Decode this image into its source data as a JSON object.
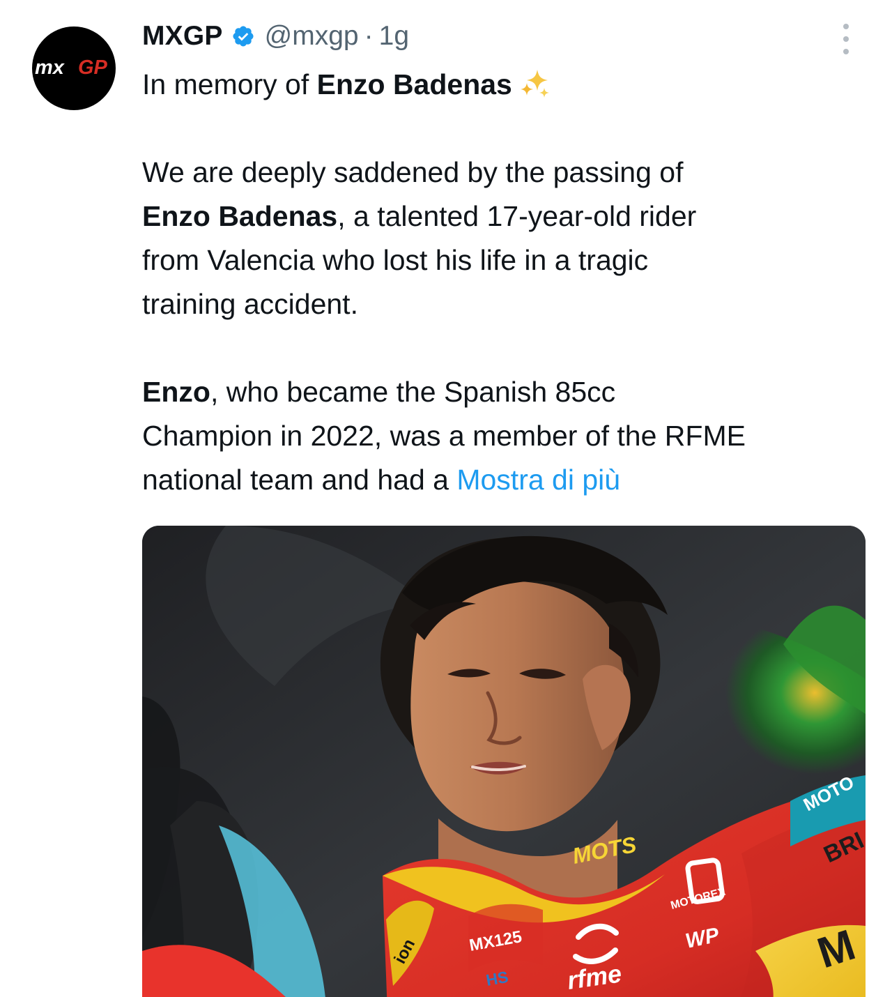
{
  "author": {
    "display_name": "MXGP",
    "handle": "@mxgp",
    "separator": "·",
    "timestamp": "1g",
    "avatar_logo_text": "MXGP",
    "verified": true,
    "verified_badge_color": "#1d9bf0"
  },
  "tweet": {
    "title_prefix": "In memory of ",
    "title_name": "Enzo Badenas",
    "title_emoji": "sparkles-icon",
    "paragraph_1": {
      "line_1": "We are deeply saddened by the passing of",
      "line_2_bold": "Enzo Badenas",
      "line_2_rest": ", a talented 17-year-old rider",
      "line_3": "from Valencia who lost his life in a tragic",
      "line_4": "training accident."
    },
    "paragraph_2": {
      "line_1_bold": "Enzo",
      "line_1_rest": ", who became the Spanish 85cc",
      "line_2": "Champion in 2022, was a member of the RFME",
      "line_3_prefix": "national team and had a ",
      "show_more": "Mostra di più"
    }
  },
  "media": {
    "alt": "photo",
    "jersey_texts": [
      "MOTS",
      "rfme",
      "MOTOREX",
      "WP",
      "MOTO",
      "BRI",
      "M"
    ]
  },
  "colors": {
    "text_primary": "#0f1419",
    "text_secondary": "#536471",
    "link": "#1d9bf0",
    "background": "#ffffff",
    "jersey_red": "#d82d24",
    "jersey_yellow": "#f2c928"
  }
}
